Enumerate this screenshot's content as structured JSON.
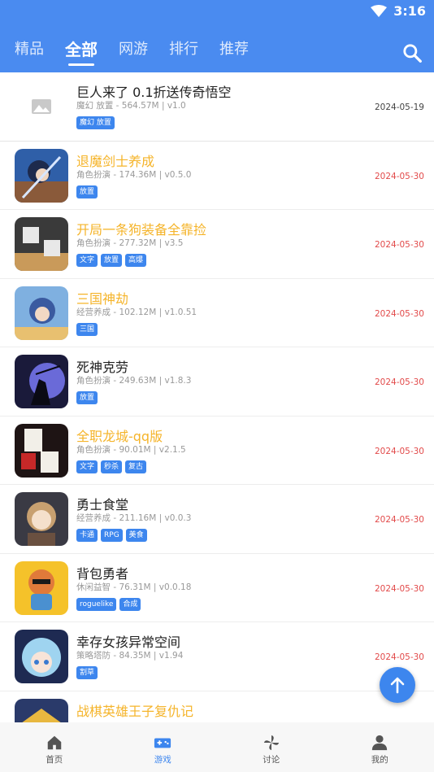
{
  "status": {
    "time": "3:16"
  },
  "tabs": [
    {
      "label": "精品",
      "active": false
    },
    {
      "label": "全部",
      "active": true
    },
    {
      "label": "网游",
      "active": false
    },
    {
      "label": "排行",
      "active": false
    },
    {
      "label": "推荐",
      "active": false
    }
  ],
  "colors": {
    "header": "#4a8bf0",
    "accent": "#3d86ee",
    "highlight_title": "#f5b42a",
    "date_red": "#e24a4a"
  },
  "games": [
    {
      "title": "巨人来了 0.1折送传奇悟空",
      "meta": "魔幻 放置 - 564.57M | v1.0",
      "tags": [
        "魔幻 放置"
      ],
      "date": "2024-05-19",
      "icon": "image-placeholder-icon"
    },
    {
      "title": "退魔剑士养成",
      "meta": "角色扮演 - 174.36M | v0.5.0",
      "tags": [
        "放置"
      ],
      "date": "2024-05-30",
      "icon": "swordsman-game-icon"
    },
    {
      "title": "开局一条狗装备全靠捡",
      "meta": "角色扮演 - 277.32M | v3.5",
      "tags": [
        "文字",
        "放置",
        "高爆"
      ],
      "date": "2024-05-30",
      "icon": "shikong-game-icon"
    },
    {
      "title": "三国神劫",
      "meta": "经营养成 - 102.12M | v1.0.51",
      "tags": [
        "三国"
      ],
      "date": "2024-05-30",
      "icon": "three-kingdoms-game-icon"
    },
    {
      "title": "死神克劳",
      "meta": "角色扮演 - 249.63M | v1.8.3",
      "tags": [
        "放置"
      ],
      "date": "2024-05-30",
      "icon": "reaper-game-icon"
    },
    {
      "title": "全职龙城-qq版",
      "meta": "角色扮演 - 90.01M | v2.1.5",
      "tags": [
        "文字",
        "秒杀",
        "复古"
      ],
      "date": "2024-05-30",
      "icon": "dragon-city-game-icon"
    },
    {
      "title": "勇士食堂",
      "meta": "经营养成 - 211.16M | v0.0.3",
      "tags": [
        "卡通",
        "RPG",
        "美食"
      ],
      "date": "2024-05-30",
      "icon": "warrior-canteen-game-icon"
    },
    {
      "title": "背包勇者",
      "meta": "休闲益智 - 76.31M | v0.0.18",
      "tags": [
        "roguelike",
        "合成"
      ],
      "date": "2024-05-30",
      "icon": "backpack-hero-game-icon"
    },
    {
      "title": "幸存女孩异常空间",
      "meta": "策略塔防 - 84.35M | v1.94",
      "tags": [
        "割草"
      ],
      "date": "2024-05-30",
      "icon": "survivor-girl-game-icon"
    },
    {
      "title": "战棋英雄王子复仇记",
      "meta": "",
      "tags": [],
      "date": "",
      "icon": "chess-hero-game-icon"
    }
  ],
  "bottom_nav": [
    {
      "label": "首页",
      "icon": "home-icon",
      "active": false
    },
    {
      "label": "游戏",
      "icon": "gamepad-icon",
      "active": true
    },
    {
      "label": "讨论",
      "icon": "pinwheel-icon",
      "active": false
    },
    {
      "label": "我的",
      "icon": "user-icon",
      "active": false
    }
  ]
}
